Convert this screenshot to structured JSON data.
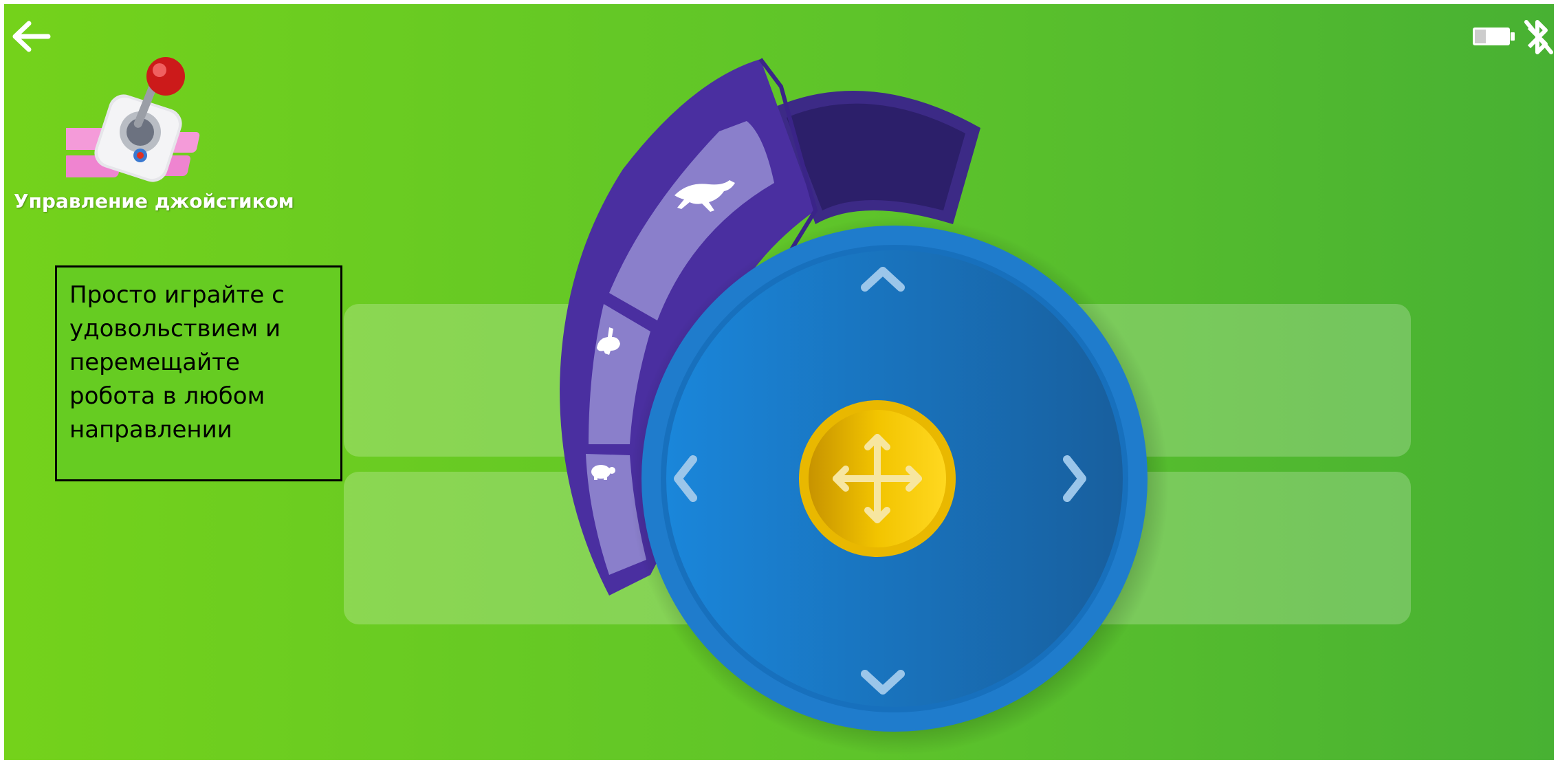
{
  "header": {
    "back_icon": "arrow-left-icon",
    "battery_icon": "battery-icon",
    "bluetooth_icon": "bluetooth-off-icon"
  },
  "app": {
    "icon": "joystick-app-icon",
    "title": "Управление джойстиком"
  },
  "info_box": {
    "lines": [
      "Просто играйте с",
      "удовольствием и",
      "перемещайте",
      "робота в любом",
      "направлении"
    ]
  },
  "speed_selector": {
    "options": [
      {
        "icon": "cheetah-icon",
        "label": "fast"
      },
      {
        "icon": "rabbit-icon",
        "label": "medium"
      },
      {
        "icon": "turtle-icon",
        "label": "slow"
      }
    ]
  },
  "joystick": {
    "center_icon": "move-arrows-icon",
    "directions": [
      "up-chevron-icon",
      "down-chevron-icon",
      "left-chevron-icon",
      "right-chevron-icon"
    ]
  },
  "colors": {
    "background": "#6ccc20",
    "joystick_ring": "#1a78c8",
    "joystick_face": "#1582d6",
    "knob": "#f6c700",
    "speed_panel": "#4a2fa0",
    "speed_option": "#8a7fcb"
  }
}
